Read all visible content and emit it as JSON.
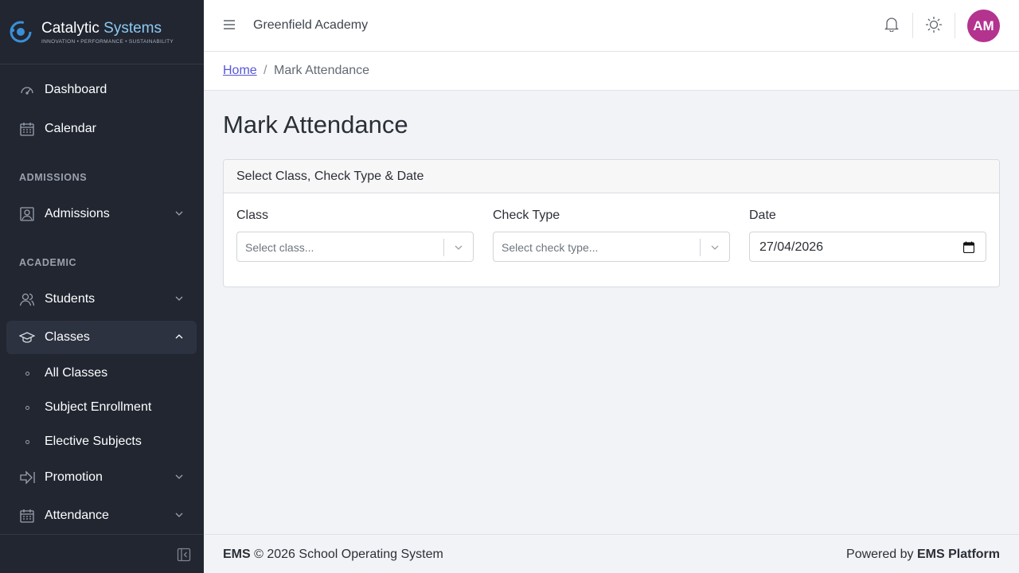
{
  "brand": {
    "name_part1": "Catalytic",
    "name_part2": "Systems",
    "tagline": "INNOVATION • PERFORMANCE • SUSTAINABILITY"
  },
  "sidebar": {
    "items": [
      {
        "label": "Dashboard",
        "icon": "speedometer-icon"
      },
      {
        "label": "Calendar",
        "icon": "calendar-icon"
      },
      {
        "label": "Admissions",
        "icon": "admissions-icon"
      },
      {
        "label": "Students",
        "icon": "students-icon"
      },
      {
        "label": "Classes",
        "icon": "graduation-cap-icon"
      },
      {
        "label": "Promotion",
        "icon": "promotion-arrow-icon"
      },
      {
        "label": "Attendance",
        "icon": "attendance-calendar-icon"
      }
    ],
    "sections": [
      "ADMISSIONS",
      "ACADEMIC"
    ],
    "classes_sub": [
      "All Classes",
      "Subject Enrollment",
      "Elective Subjects"
    ]
  },
  "header": {
    "school": "Greenfield Academy",
    "avatar_initials": "AM",
    "avatar_color": "#b3338f"
  },
  "breadcrumb": {
    "home": "Home",
    "separator": "/",
    "current": "Mark Attendance"
  },
  "main": {
    "title": "Mark Attendance",
    "card_title": "Select Class, Check Type & Date",
    "class_label": "Class",
    "class_placeholder": "Select class...",
    "check_type_label": "Check Type",
    "check_type_placeholder": "Select check type...",
    "date_label": "Date",
    "date_value": "27/04/2026"
  },
  "footer": {
    "left_bold": "EMS",
    "left_rest": "© 2026 School Operating System",
    "right_prefix": "Powered by",
    "right_bold": "EMS Platform"
  },
  "colors": {
    "sidebar_bg": "#212631",
    "accent_link": "#5856d6",
    "brand_accent": "#8ec9f2"
  }
}
